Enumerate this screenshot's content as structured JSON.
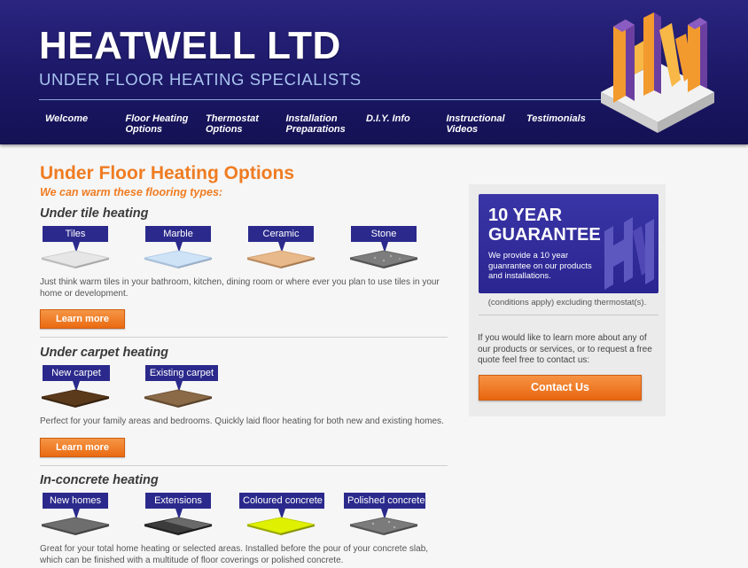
{
  "header": {
    "brand": "HEATWELL LTD",
    "tagline": "UNDER FLOOR HEATING SPECIALISTS",
    "nav": [
      {
        "label": "Welcome"
      },
      {
        "label": "Floor Heating Options"
      },
      {
        "label": "Thermostat Options"
      },
      {
        "label": "Installation Preparations"
      },
      {
        "label": "D.I.Y. Info"
      },
      {
        "label": "Instructional Videos"
      },
      {
        "label": "Testimonials"
      }
    ]
  },
  "main": {
    "title": "Under Floor Heating Options",
    "subtitle": "We can warm these flooring types:",
    "sections": [
      {
        "title": "Under tile heating",
        "tiles": [
          {
            "label": "Tiles",
            "color": "#e6e6e6"
          },
          {
            "label": "Marble",
            "color": "#cfe3f7"
          },
          {
            "label": "Ceramic",
            "color": "#e8b98a"
          },
          {
            "label": "Stone",
            "color": "#7d7d7d"
          }
        ],
        "text": "Just think warm tiles in your bathroom, kitchen, dining room or where ever you plan to use tiles in your home or development.",
        "button": "Learn more"
      },
      {
        "title": "Under carpet heating",
        "tiles": [
          {
            "label": "New carpet",
            "color": "#5b3a1c"
          },
          {
            "label": "Existing carpet",
            "color": "#8a6a47"
          }
        ],
        "text": "Perfect for your family areas and bedrooms. Quickly laid floor heating for both new and existing homes.",
        "button": "Learn more"
      },
      {
        "title": "In-concrete heating",
        "tiles": [
          {
            "label": "New homes",
            "color": "#6e6e6e"
          },
          {
            "label": "Extensions",
            "color": "#3c3c3c"
          },
          {
            "label": "Coloured concrete",
            "color": "#dff000"
          },
          {
            "label": "Polished concrete",
            "color": "#7b7b7b"
          }
        ],
        "text": "Great for your total home heating or selected areas. Installed before the pour of your concrete slab, which can be finished with a multitude of floor coverings or polished concrete."
      }
    ]
  },
  "sidebar": {
    "guarantee_line1": "10 YEAR",
    "guarantee_line2": "GUARANTEE",
    "guarantee_text": "We provide a 10 year guanrantee on our products and installations.",
    "conditions": "(conditions apply) excluding thermostat(s).",
    "contact_text": "If you would like to learn more about any of our products or services, or to request a free quote feel free to contact us:",
    "contact_button": "Contact Us"
  },
  "colors": {
    "header": "#1c1866",
    "accent": "#ef7c22",
    "label_bg": "#2b2a8c"
  }
}
